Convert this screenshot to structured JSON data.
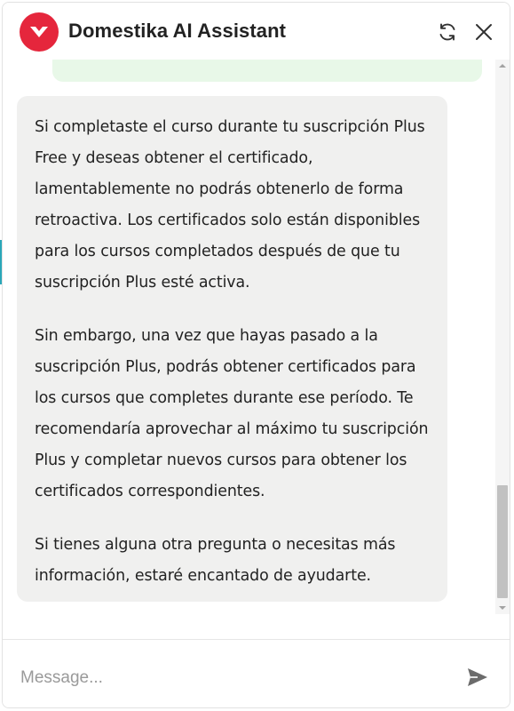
{
  "header": {
    "title": "Domestika AI Assistant",
    "logo_icon": "domestika-logo-icon",
    "refresh_icon": "refresh-icon",
    "close_icon": "close-icon",
    "brand_color": "#e5263c"
  },
  "messages": {
    "user_partial_text": "",
    "assistant": {
      "paragraphs": [
        "Si completaste el curso durante tu suscripción Plus Free y deseas obtener el certificado, lamentablemente no podrás obtenerlo de forma retroactiva. Los certificados solo están disponibles para los cursos completados después de que tu suscripción Plus esté activa.",
        "Sin embargo, una vez que hayas pasado a la suscripción Plus, podrás obtener certificados para los cursos que completes durante ese período. Te recomendaría aprovechar al máximo tu suscripción Plus y completar nuevos cursos para obtener los certificados correspondientes.",
        "Si tienes alguna otra pregunta o necesitas más información, estaré encantado de ayudarte."
      ]
    },
    "user_bubble_color": "#e8f8e8",
    "assistant_bubble_color": "#f0f0ef"
  },
  "composer": {
    "placeholder": "Message...",
    "value": "",
    "send_icon": "send-icon"
  }
}
